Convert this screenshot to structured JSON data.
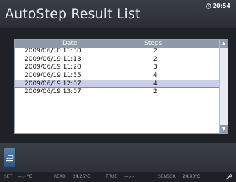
{
  "header": {
    "title": "AutoStep Result List",
    "time": "20:54"
  },
  "list": {
    "columns": {
      "date": "Date",
      "steps": "Steps"
    },
    "rows": [
      {
        "date": "2009/06/10 11:30",
        "steps": "2"
      },
      {
        "date": "2009/06/19 11:13",
        "steps": "2"
      },
      {
        "date": "2009/06/19 11:20",
        "steps": "3"
      },
      {
        "date": "2009/06/19 11:55",
        "steps": "4"
      },
      {
        "date": "2009/06/19 12:07",
        "steps": "4"
      },
      {
        "date": "2009/06/19 13:07",
        "steps": "2"
      }
    ],
    "selected_index": 4
  },
  "status_bar": {
    "set_label": "SET",
    "set_value": "---.- °C",
    "read_label": "READ",
    "read_value": "24.26°C",
    "true_label": "TRUE",
    "true_value": "---.---",
    "sensor_label": "SENSOR",
    "sensor_value": "24.93°C"
  },
  "icons": {
    "clock": "clock-icon",
    "back": "back-arrow-icon",
    "settings": "wrench-icon"
  }
}
